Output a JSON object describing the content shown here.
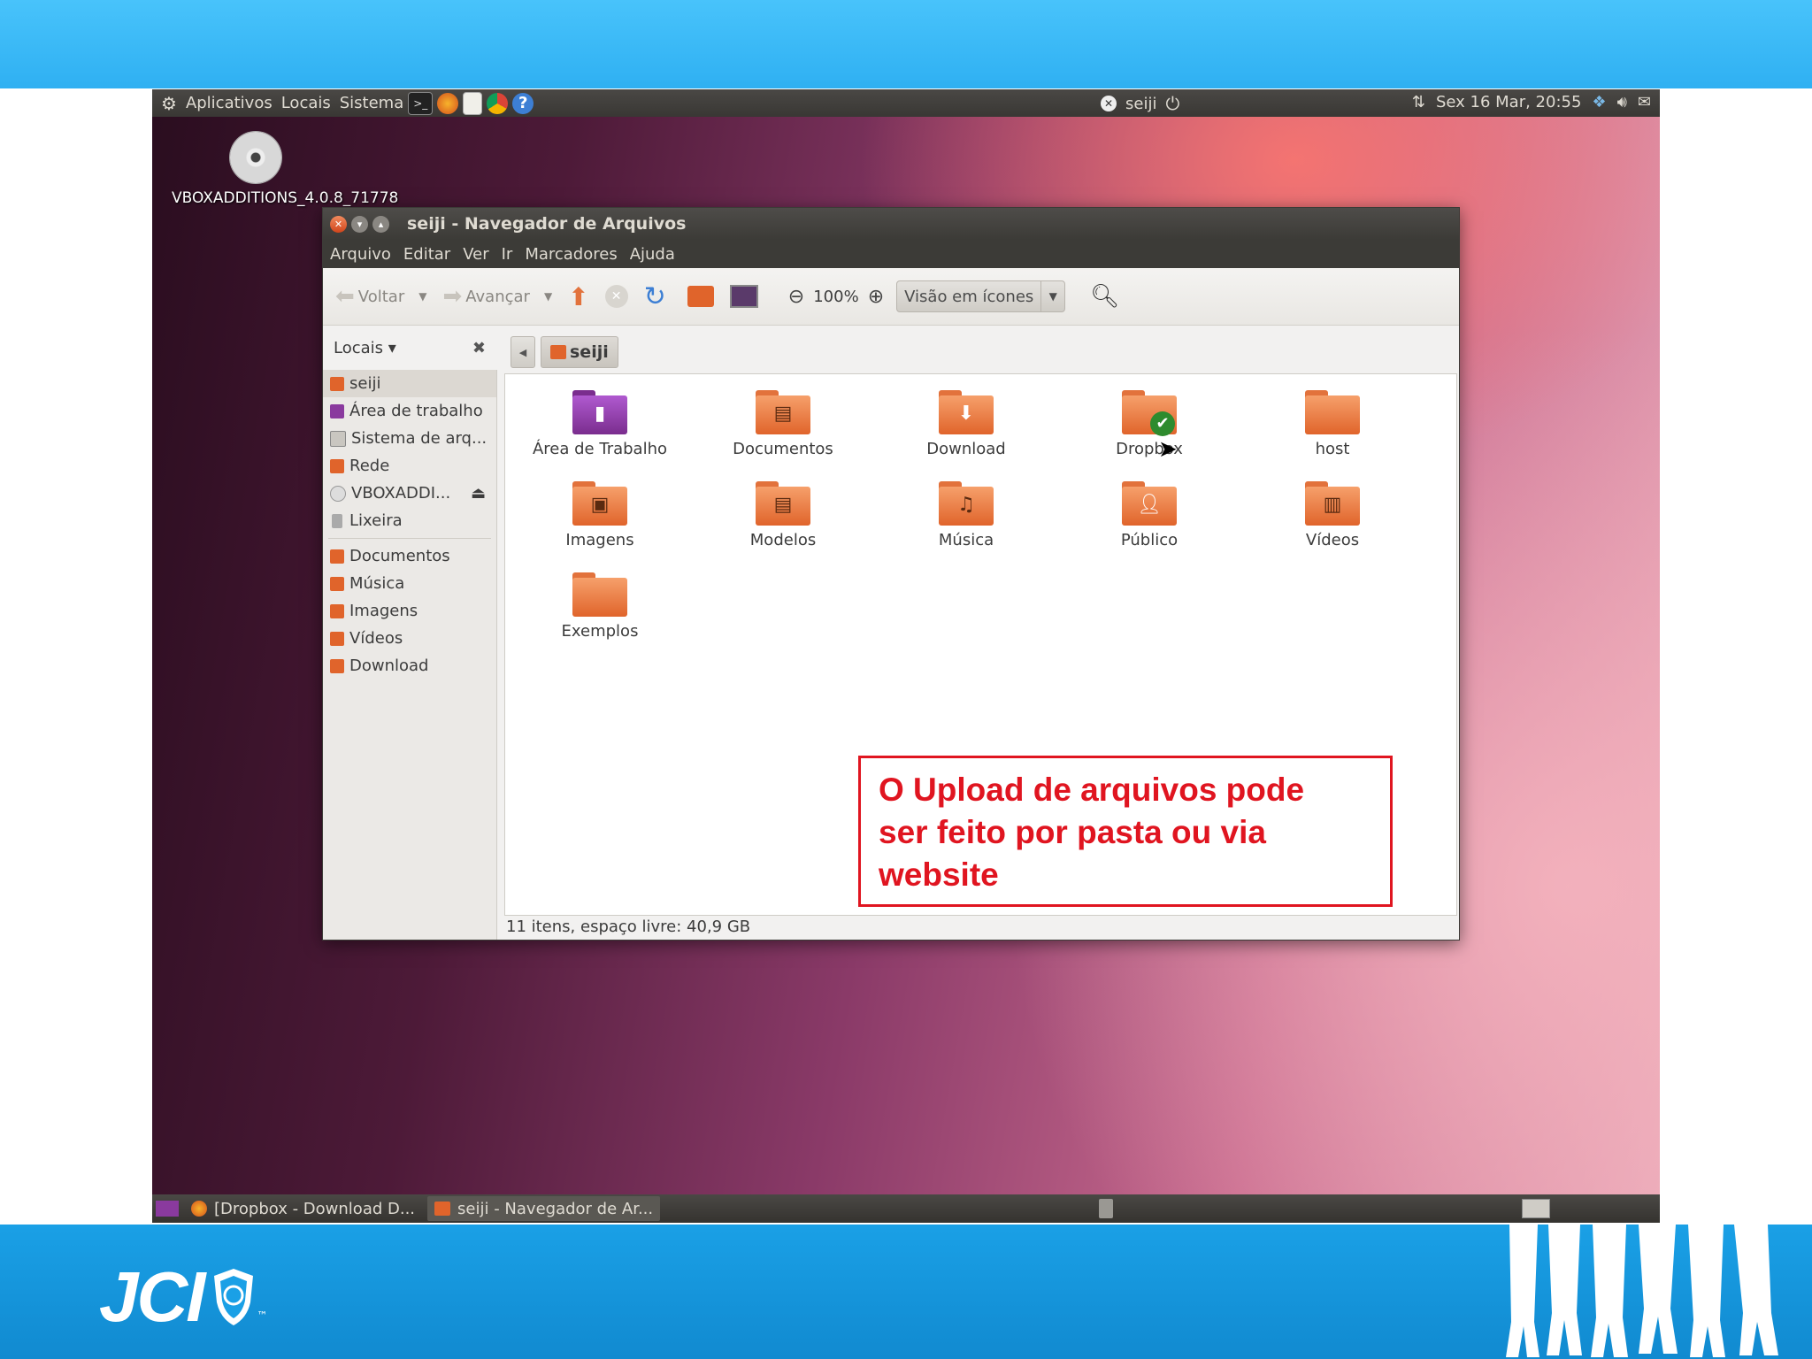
{
  "desktop": {
    "top_panel": {
      "menus": [
        "Aplicativos",
        "Locais",
        "Sistema"
      ],
      "user": "seiji",
      "datetime": "Sex 16 Mar, 20:55"
    },
    "desktop_icon_label": "VBOXADDITIONS_4.0.8_71778",
    "taskbar": {
      "tasks": [
        "[Dropbox - Download D...",
        "seiji - Navegador de Ar..."
      ]
    }
  },
  "window": {
    "title": "seiji - Navegador de Arquivos",
    "menubar": [
      "Arquivo",
      "Editar",
      "Ver",
      "Ir",
      "Marcadores",
      "Ajuda"
    ],
    "toolbar": {
      "back": "Voltar",
      "forward": "Avançar",
      "zoom": "100%",
      "view_mode": "Visão em ícones"
    },
    "sidebar": {
      "header": "Locais ▾",
      "places": [
        "seiji",
        "Área de trabalho",
        "Sistema de arq...",
        "Rede",
        "VBOXADDI...",
        "Lixeira"
      ],
      "bookmarks": [
        "Documentos",
        "Música",
        "Imagens",
        "Vídeos",
        "Download"
      ]
    },
    "pathbar": {
      "current": "seiji"
    },
    "files": [
      "Área de Trabalho",
      "Documentos",
      "Download",
      "Dropbox",
      "host",
      "Imagens",
      "Modelos",
      "Música",
      "Público",
      "Vídeos",
      "Exemplos"
    ],
    "status": "11 itens, espaço livre: 40,9 GB"
  },
  "callout": {
    "lines": [
      "O Upload de arquivos pode",
      "ser feito por pasta ou via",
      "website"
    ]
  },
  "slide": {
    "logo_text": "JCI",
    "logo_tm": "™"
  },
  "colors": {
    "band_blue": "#1aa0e6",
    "callout_red": "#e01520",
    "folder_orange": "#e0642b"
  }
}
